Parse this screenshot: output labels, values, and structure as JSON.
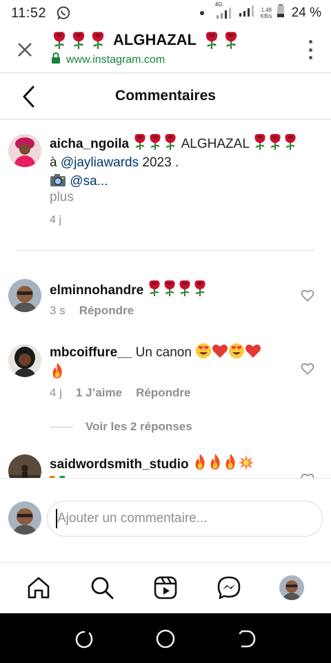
{
  "status_bar": {
    "time": "11:52",
    "net_gen": "4G",
    "net_speed_value": "1.48",
    "net_speed_unit": "KB/s",
    "battery": "24 %"
  },
  "browser": {
    "title_text": "ALGHAZAL",
    "url": "www.instagram.com"
  },
  "header": {
    "title": "Commentaires"
  },
  "caption": {
    "username": "aicha_ngoila",
    "text_main": "ALGHAZAL",
    "prefix_a": "à",
    "mention_1": "@jayliawards",
    "year": "2023 .",
    "mention_2": "@sa...",
    "more": "plus",
    "time": "4 j"
  },
  "comments": [
    {
      "username": "elminnohandre",
      "time": "3 s",
      "reply_label": "Répondre"
    },
    {
      "username": "mbcoiffure__",
      "text": "Un canon",
      "time": "4 j",
      "likes_label": "1 J’aime",
      "reply_label": "Répondre"
    },
    {
      "username": "saidwordsmith_studio"
    }
  ],
  "view_replies": "Voir les 2 réponses",
  "composer": {
    "placeholder": "Ajouter un commentaire..."
  },
  "icons": {
    "close": "close-icon",
    "menu": "more-vertical-icon",
    "back": "chevron-left-icon",
    "heart": "heart-outline-icon",
    "home": "home-icon",
    "search": "search-icon",
    "reels": "reels-icon",
    "messenger": "messenger-icon"
  },
  "colors": {
    "mention": "#00376b",
    "secure": "#188038",
    "muted": "#8e8e8e",
    "rose": "#c8102e"
  }
}
